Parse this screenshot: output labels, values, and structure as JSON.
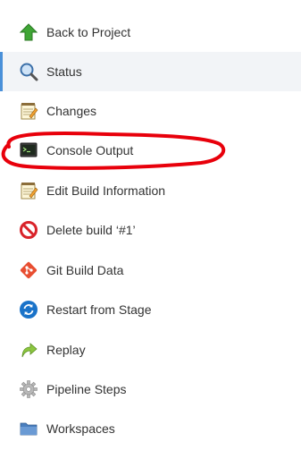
{
  "sidebar": {
    "items": [
      {
        "label": "Back to Project",
        "icon": "up-arrow-icon"
      },
      {
        "label": "Status",
        "icon": "magnifier-icon"
      },
      {
        "label": "Changes",
        "icon": "notepad-icon"
      },
      {
        "label": "Console Output",
        "icon": "terminal-icon"
      },
      {
        "label": "Edit Build Information",
        "icon": "notepad-pencil-icon"
      },
      {
        "label": "Delete build ‘#1’",
        "icon": "no-entry-icon"
      },
      {
        "label": "Git Build Data",
        "icon": "git-icon"
      },
      {
        "label": "Restart from Stage",
        "icon": "restart-icon"
      },
      {
        "label": "Replay",
        "icon": "replay-arrow-icon"
      },
      {
        "label": "Pipeline Steps",
        "icon": "gear-icon"
      },
      {
        "label": "Workspaces",
        "icon": "folder-icon"
      }
    ],
    "active_index": 1
  },
  "colors": {
    "accent": "#4a90d9",
    "annotation": "#e8000b",
    "text": "#333333"
  }
}
